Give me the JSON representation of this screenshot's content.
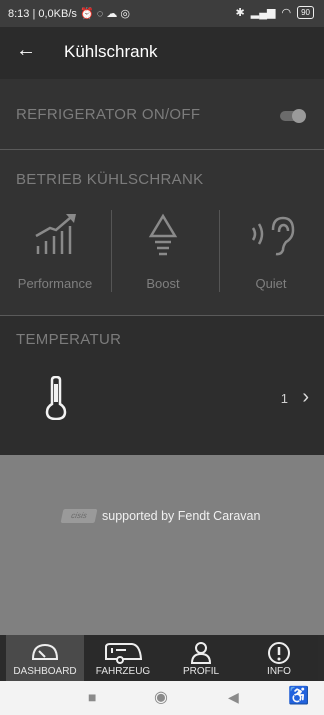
{
  "status": {
    "left_text": "8:13 | 0,0KB/s",
    "battery": "90"
  },
  "appbar": {
    "title": "Kühlschrank"
  },
  "refrigerator": {
    "label": "REFRIGERATOR ON/OFF",
    "on": true
  },
  "modes": {
    "label": "BETRIEB KÜHLSCHRANK",
    "items": [
      {
        "label": "Performance",
        "icon": "performance-icon"
      },
      {
        "label": "Boost",
        "icon": "boost-icon"
      },
      {
        "label": "Quiet",
        "icon": "quiet-icon"
      }
    ]
  },
  "temperature": {
    "label": "TEMPERATUR",
    "value": "1"
  },
  "footer": {
    "supported_text": "supported by Fendt Caravan",
    "logo_text": "cisis"
  },
  "bottom_nav": [
    {
      "label": "DASHBOARD",
      "icon": "dashboard-icon",
      "active": true
    },
    {
      "label": "FAHRZEUG",
      "icon": "vehicle-icon",
      "active": false
    },
    {
      "label": "PROFIL",
      "icon": "profile-icon",
      "active": false
    },
    {
      "label": "INFO",
      "icon": "info-icon",
      "active": false
    }
  ],
  "colors": {
    "background": "#2b2b2b",
    "section": "#333333",
    "muted_label": "#7c7c7c",
    "footer": "#808080"
  }
}
